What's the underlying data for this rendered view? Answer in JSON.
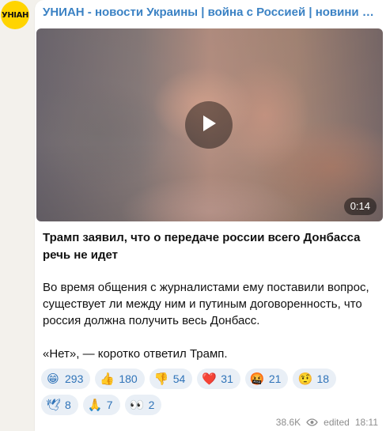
{
  "channel": {
    "title": "УНИАН - новости Украины | война с Россией | новини України, війна",
    "avatar_text": "УНІАН",
    "avatar_color": "#ffd400",
    "accent_color": "#3b82c4"
  },
  "video": {
    "duration": "0:14",
    "play_icon": "play-icon"
  },
  "post": {
    "headline": "Трамп заявил, что о передаче россии всего Донбасса речь не идет",
    "paragraph1": "Во время общения с журналистами ему поставили вопрос, существует ли между ним и путиным договоренность, что россия должна получить весь Донбасс.",
    "paragraph2": "«Нет», — коротко ответил Трамп."
  },
  "reactions": [
    {
      "emoji": "😁",
      "icon": "grinning-face-icon",
      "count": "293"
    },
    {
      "emoji": "👍",
      "icon": "thumbs-up-icon",
      "count": "180"
    },
    {
      "emoji": "👎",
      "icon": "thumbs-down-icon",
      "count": "54"
    },
    {
      "emoji": "❤️",
      "icon": "heart-icon",
      "count": "31"
    },
    {
      "emoji": "🤬",
      "icon": "angry-face-icon",
      "count": "21"
    },
    {
      "emoji": "🤨",
      "icon": "raised-eyebrow-face-icon",
      "count": "18"
    },
    {
      "emoji": "🕊",
      "icon": "dove-icon",
      "count": "8"
    },
    {
      "emoji": "🙏",
      "icon": "folded-hands-icon",
      "count": "7"
    },
    {
      "emoji": "👀",
      "icon": "eyes-icon",
      "count": "2"
    }
  ],
  "meta": {
    "views": "38.6K",
    "edited": "edited",
    "time": "18:11",
    "eye_icon": "eye-icon"
  }
}
